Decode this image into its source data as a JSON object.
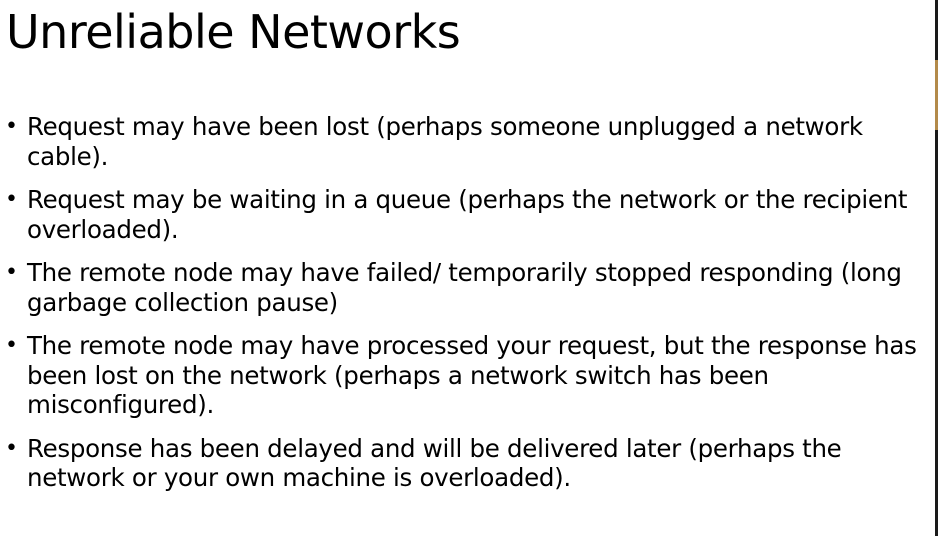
{
  "slide": {
    "title": "Unreliable Networks",
    "bullet_char": "•",
    "bullets": [
      {
        "line1": "Request may have been lost (perhaps someone unplugged a network",
        "line2": "cable).",
        "line3": ""
      },
      {
        "line1": "Request may be waiting in a queue (perhaps the network or the recipient",
        "line2": "overloaded).",
        "line3": ""
      },
      {
        "line1": "The remote node may have failed/ temporarily stopped responding (long",
        "line2": "garbage collection pause)",
        "line3": ""
      },
      {
        "line1": "The remote node may have processed your request, but the response has",
        "line2": "been lost on the network (perhaps a network switch has been",
        "line3": "misconfigured)."
      },
      {
        "line1": "Response has been delayed and will be delivered later (perhaps the",
        "line2": "network or your own machine is overloaded).",
        "line3": ""
      }
    ]
  }
}
